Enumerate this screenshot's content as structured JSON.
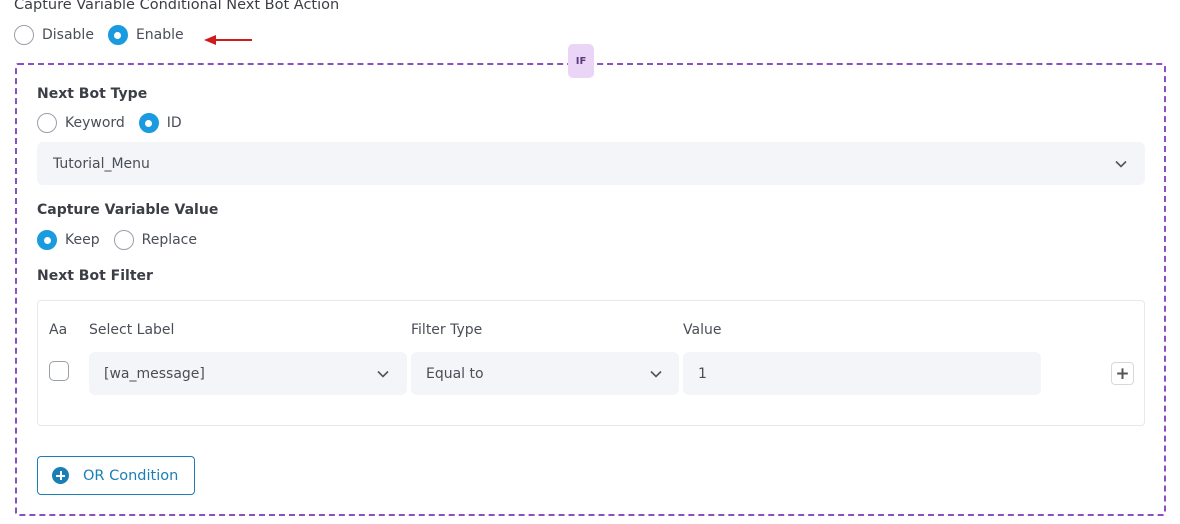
{
  "header": {
    "title": "Capture Variable Conditional Next Bot Action",
    "options": [
      {
        "label": "Disable",
        "selected": false
      },
      {
        "label": "Enable",
        "selected": true
      }
    ]
  },
  "condition_block": {
    "badge": "IF",
    "next_bot_type": {
      "label": "Next Bot Type",
      "options": [
        {
          "label": "Keyword",
          "selected": false
        },
        {
          "label": "ID",
          "selected": true
        }
      ],
      "selected_value": "Tutorial_Menu"
    },
    "capture_variable_value": {
      "label": "Capture Variable Value",
      "options": [
        {
          "label": "Keep",
          "selected": true
        },
        {
          "label": "Replace",
          "selected": false
        }
      ]
    },
    "next_bot_filter": {
      "label": "Next Bot Filter",
      "columns": {
        "case": "Aa",
        "label": "Select Label",
        "filter_type": "Filter Type",
        "value": "Value"
      },
      "row": {
        "case_checked": false,
        "label": "[wa_message]",
        "filter_type": "Equal to",
        "value": "1"
      }
    },
    "or_condition_label": "OR Condition"
  },
  "colors": {
    "accent": "#1a9be0",
    "button": "#1a7fb5",
    "dashed_border": "#8a4fc4",
    "badge_bg": "#ead5f7",
    "arrow": "#d11a1a"
  },
  "icons": [
    "chevron-down-icon",
    "plus-icon",
    "plus-circle-icon",
    "arrow-left-icon"
  ]
}
